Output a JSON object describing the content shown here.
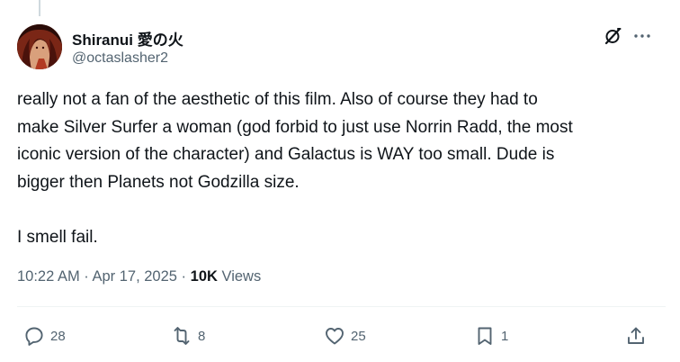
{
  "author": {
    "display_name": "Shiranui 愛の火",
    "handle": "@octaslasher2"
  },
  "post": {
    "text": "really not a fan of the aesthetic of this film. Also of course they had to\nmake Silver Surfer a woman (god forbid to just use Norrin Radd, the most\niconic version of the character) and Galactus is WAY too small. Dude is\nbigger then Planets not Godzilla size.\n\nI smell fail.",
    "timestamp": "10:22 AM · Apr 17, 2025",
    "separator": " · ",
    "views_count": "10K",
    "views_label": " Views"
  },
  "actions": {
    "replies": "28",
    "reposts": "8",
    "likes": "25",
    "bookmarks": "1"
  },
  "icons": {
    "header": [
      "grok-icon",
      "more-options-icon"
    ],
    "actions": [
      "reply-icon",
      "repost-icon",
      "like-icon",
      "bookmark-icon",
      "share-icon"
    ]
  },
  "colors": {
    "text_primary": "#0f1419",
    "text_secondary": "#536471",
    "divider": "#eff3f4",
    "thread_line": "#cfd9de"
  }
}
